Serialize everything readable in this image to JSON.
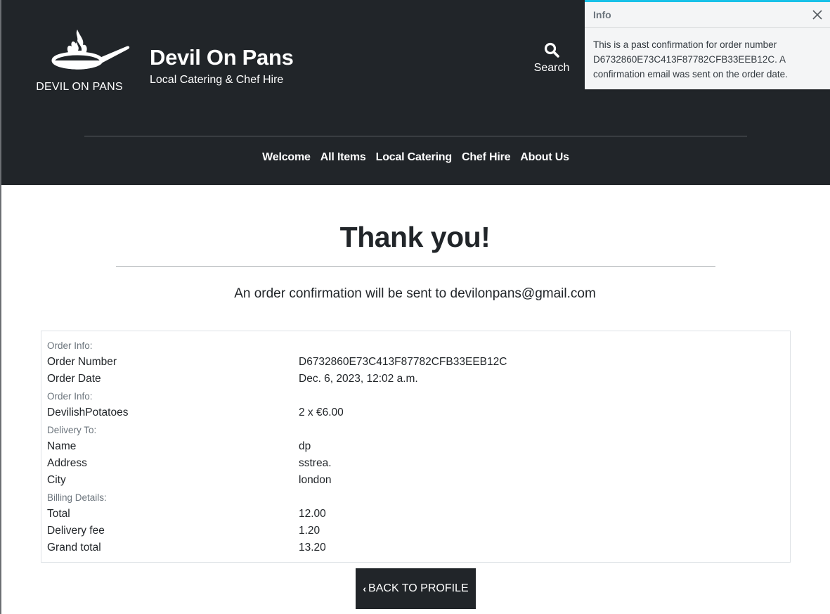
{
  "brand": {
    "logo_text": "DEVIL ON PANS",
    "title": "Devil On Pans",
    "tagline": "Local Catering & Chef Hire"
  },
  "header": {
    "search_label": "Search",
    "search_icon": "search-icon"
  },
  "nav": {
    "items": [
      "Welcome",
      "All Items",
      "Local Catering",
      "Chef Hire",
      "About Us"
    ]
  },
  "toast": {
    "title": "Info",
    "message": "This is a past confirmation for order number D6732860E73C413F87782CFB33EEB12C. A confirmation email was sent on the order date.",
    "accent_color": "#17c1e8",
    "close_icon": "close-icon"
  },
  "main": {
    "title": "Thank you!",
    "confirmation_message": "An order confirmation will be sent to devilonpans@gmail.com"
  },
  "order": {
    "order_info_label": "Order Info:",
    "order_number_label": "Order Number",
    "order_number": "D6732860E73C413F87782CFB33EEB12C",
    "order_date_label": "Order Date",
    "order_date": "Dec. 6, 2023, 12:02 a.m.",
    "items_label": "Order Info:",
    "items": [
      {
        "name": "DevilishPotatoes",
        "qty_price": "2 x €6.00"
      }
    ],
    "delivery_label": "Delivery To:",
    "name_label": "Name",
    "name": "dp",
    "address_label": "Address",
    "address": "sstrea.",
    "city_label": "City",
    "city": "london",
    "billing_label": "Billing Details:",
    "total_label": "Total",
    "total": "12.00",
    "delivery_fee_label": "Delivery fee",
    "delivery_fee": "1.20",
    "grand_total_label": "Grand total",
    "grand_total": "13.20"
  },
  "actions": {
    "back_label": "BACK TO PROFILE",
    "back_icon": "chevron-left-icon"
  },
  "colors": {
    "header_bg": "#212529",
    "text": "#212529",
    "muted": "#6c757d"
  }
}
